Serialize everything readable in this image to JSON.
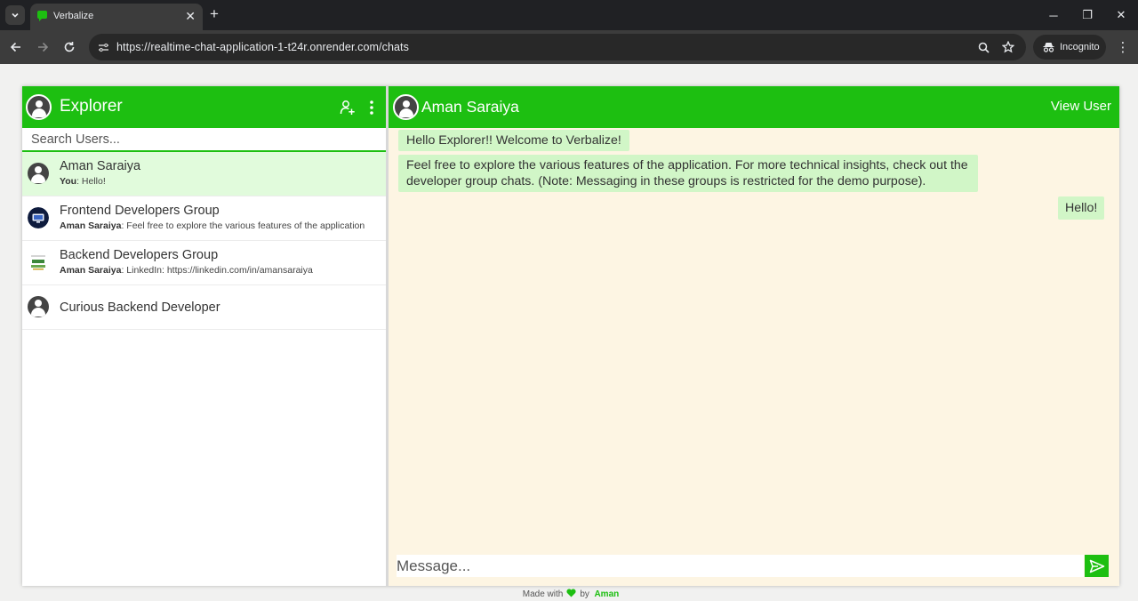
{
  "browser": {
    "tab_title": "Verbalize",
    "url": "https://realtime-chat-application-1-t24r.onrender.com/chats",
    "profile_label": "Incognito"
  },
  "sidebar": {
    "title": "Explorer",
    "search_placeholder": "Search Users...",
    "chats": [
      {
        "name": "Aman Saraiya",
        "sender": "You",
        "preview": ": Hello!",
        "active": true,
        "avatar": "default-avatar"
      },
      {
        "name": "Frontend Developers Group",
        "sender": "Aman Saraiya",
        "preview": ": Feel free to explore the various features of the application",
        "active": false,
        "avatar": "frontend-group-image"
      },
      {
        "name": "Backend Developers Group",
        "sender": "Aman Saraiya",
        "preview": ": LinkedIn: https://linkedin.com/in/amansaraiya",
        "active": false,
        "avatar": "nodejs-group-image"
      },
      {
        "name": "Curious Backend Developer",
        "sender": "",
        "preview": "",
        "active": false,
        "avatar": "default-avatar"
      }
    ]
  },
  "conversation": {
    "title": "Aman Saraiya",
    "view_user_label": "View User",
    "messages": [
      {
        "text": "Hello Explorer!! Welcome to Verbalize!",
        "side": "left"
      },
      {
        "text": "Feel free to explore the various features of the application. For more technical insights, check out the developer group chats. (Note: Messaging in these groups is restricted for the demo purpose).",
        "side": "left"
      },
      {
        "text": "Hello!",
        "side": "right"
      }
    ],
    "input_placeholder": "Message..."
  },
  "footer": {
    "made_with": "Made with",
    "by": "by",
    "author": "Aman"
  },
  "colors": {
    "brand": "#1dbf11",
    "message_bubble": "#d1f6c7",
    "chat_background": "#fdf5e3",
    "active_chat": "#e1fbdc"
  }
}
